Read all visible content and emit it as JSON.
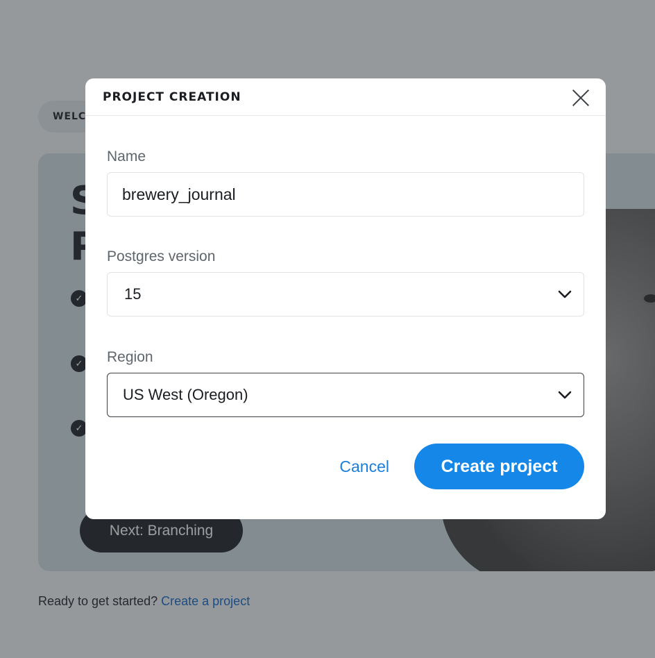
{
  "background": {
    "welcome_pill": "WELCOME",
    "hero_title": "S\nP",
    "next_button_label": "Next: Branching",
    "footer": {
      "text": "Ready to get started?",
      "link": "Create a project"
    }
  },
  "modal": {
    "title": "PROJECT CREATION",
    "fields": {
      "name": {
        "label": "Name",
        "value": "brewery_journal"
      },
      "postgres_version": {
        "label": "Postgres version",
        "value": "15"
      },
      "region": {
        "label": "Region",
        "value": "US West (Oregon)"
      }
    },
    "cancel_label": "Cancel",
    "create_label": "Create project"
  },
  "icons": {
    "close": "close-icon",
    "chevron": "chevron-down-icon",
    "check": "check-circle-icon"
  },
  "colors": {
    "primary": "#1487e8",
    "link": "#1a7fdb",
    "overlay": "rgba(48,52,56,0.48)"
  }
}
